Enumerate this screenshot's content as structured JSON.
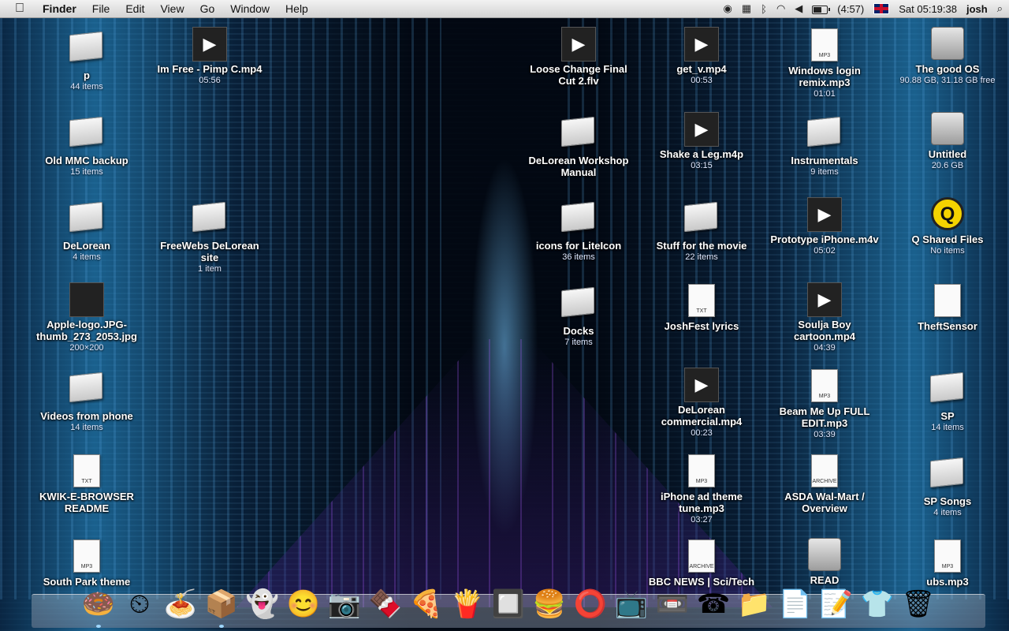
{
  "menubar": {
    "apple_icon": "apple-logo-icon",
    "app": "Finder",
    "menus": [
      "File",
      "Edit",
      "View",
      "Go",
      "Window",
      "Help"
    ],
    "battery": "(4:57)",
    "clock": "Sat 05:19:38",
    "user": "josh"
  },
  "desktop": {
    "icons": [
      {
        "name": "p",
        "sub": "44 items",
        "type": "folder"
      },
      {
        "name": "Old MMC backup",
        "sub": "15 items",
        "type": "folder"
      },
      {
        "name": "DeLorean",
        "sub": "4 items",
        "type": "folder"
      },
      {
        "name": "Apple-logo.JPG-thumb_273_2053.jpg",
        "sub": "200×200",
        "type": "image"
      },
      {
        "name": "Videos from phone",
        "sub": "14 items",
        "type": "folder"
      },
      {
        "name": "KWIK-E-BROWSER README",
        "sub": "",
        "type": "txt"
      },
      {
        "name": "South Park theme",
        "sub": "",
        "type": "mp3"
      },
      {
        "name": "Im Free - Pimp C.mp4",
        "sub": "05:56",
        "type": "video"
      },
      {
        "name": "FreeWebs DeLorean site",
        "sub": "1 item",
        "type": "folder"
      },
      {
        "name": "Loose Change Final Cut 2.flv",
        "sub": "",
        "type": "video"
      },
      {
        "name": "DeLorean Workshop Manual",
        "sub": "",
        "type": "folder"
      },
      {
        "name": "icons for LiteIcon",
        "sub": "36 items",
        "type": "folder"
      },
      {
        "name": "Docks",
        "sub": "7 items",
        "type": "folder"
      },
      {
        "name": "get_v.mp4",
        "sub": "00:53",
        "type": "video"
      },
      {
        "name": "Shake a Leg.m4p",
        "sub": "03:15",
        "type": "video"
      },
      {
        "name": "Stuff for the movie",
        "sub": "22 items",
        "type": "folder"
      },
      {
        "name": "JoshFest lyrics",
        "sub": "",
        "type": "txt"
      },
      {
        "name": "DeLorean commercial.mp4",
        "sub": "00:23",
        "type": "video"
      },
      {
        "name": "iPhone ad theme tune.mp3",
        "sub": "03:27",
        "type": "mp3"
      },
      {
        "name": "BBC NEWS | Sci/Tech",
        "sub": "",
        "type": "archive"
      },
      {
        "name": "Windows login remix.mp3",
        "sub": "01:01",
        "type": "mp3"
      },
      {
        "name": "Instrumentals",
        "sub": "9 items",
        "type": "folder"
      },
      {
        "name": "Prototype iPhone.m4v",
        "sub": "05:02",
        "type": "video"
      },
      {
        "name": "Soulja Boy cartoon.mp4",
        "sub": "04:39",
        "type": "video"
      },
      {
        "name": "Beam Me Up FULL EDIT.mp3",
        "sub": "03:39",
        "type": "mp3"
      },
      {
        "name": "ASDA Wal-Mart / Overview",
        "sub": "",
        "type": "archive"
      },
      {
        "name": "READ",
        "sub": "",
        "type": "disk"
      },
      {
        "name": "The good OS",
        "sub": "90.88 GB, 31.18 GB free",
        "type": "disk"
      },
      {
        "name": "Untitled",
        "sub": "20.6 GB",
        "type": "disk"
      },
      {
        "name": "Q Shared Files",
        "sub": "No items",
        "type": "q"
      },
      {
        "name": "TheftSensor",
        "sub": "",
        "type": "doc"
      },
      {
        "name": "SP",
        "sub": "14 items",
        "type": "folder"
      },
      {
        "name": "SP Songs",
        "sub": "4 items",
        "type": "folder"
      },
      {
        "name": "ubs.mp3",
        "sub": "",
        "type": "mp3"
      }
    ]
  },
  "dock": {
    "items": [
      {
        "icon": "donut-icon",
        "glyph": "🍩",
        "running": true
      },
      {
        "icon": "time-machine-icon",
        "glyph": "⏲",
        "running": false
      },
      {
        "icon": "pasta-icon",
        "glyph": "🍝",
        "running": false
      },
      {
        "icon": "tardis-icon",
        "glyph": "📦",
        "running": true
      },
      {
        "icon": "ghost-icon",
        "glyph": "👻",
        "running": false
      },
      {
        "icon": "smiley-icon",
        "glyph": "😊",
        "running": false
      },
      {
        "icon": "camera-lens-icon",
        "glyph": "📷",
        "running": false
      },
      {
        "icon": "chocolate-icon",
        "glyph": "🍫",
        "running": false
      },
      {
        "icon": "pizza-icon",
        "glyph": "🍕",
        "running": false
      },
      {
        "icon": "fries-icon",
        "glyph": "🍟",
        "running": false
      },
      {
        "icon": "switch-icon",
        "glyph": "🔲",
        "running": false
      },
      {
        "icon": "burger-icon",
        "glyph": "🍔",
        "running": false
      },
      {
        "icon": "onion-rings-icon",
        "glyph": "⭕",
        "running": false
      },
      {
        "icon": "apple-tv-icon",
        "glyph": "📺",
        "running": false
      },
      {
        "icon": "tape-icon",
        "glyph": "📼",
        "running": false
      },
      {
        "icon": "phone-icon",
        "glyph": "☎",
        "running": false
      },
      {
        "icon": "folder-icon",
        "glyph": "📁",
        "running": false
      },
      {
        "icon": "log-icon",
        "glyph": "📄",
        "running": false
      },
      {
        "icon": "txt-icon",
        "glyph": "📝",
        "running": false
      },
      {
        "icon": "tshirt-icon",
        "glyph": "👕",
        "running": false
      },
      {
        "icon": "trash-icon",
        "glyph": "🗑",
        "running": false
      }
    ]
  }
}
